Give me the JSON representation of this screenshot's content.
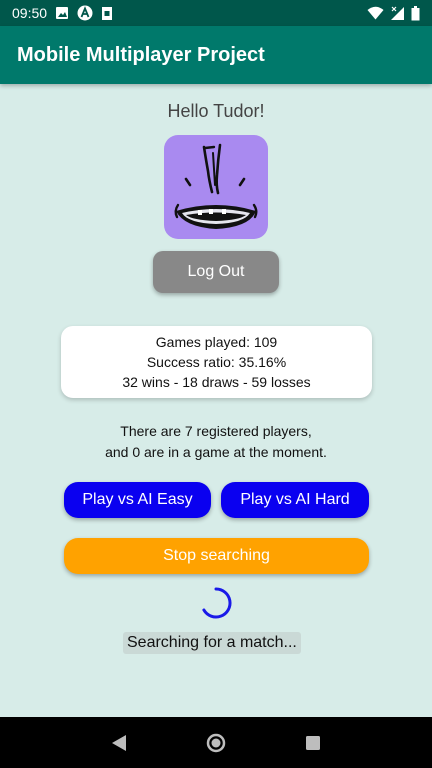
{
  "status_bar": {
    "time": "09:50",
    "left_icons": [
      "image-icon",
      "app-a-icon",
      "sd-card-icon"
    ],
    "right_icons": [
      "wifi-icon",
      "signal-icon",
      "battery-icon"
    ]
  },
  "app_bar": {
    "title": "Mobile Multiplayer Project"
  },
  "profile": {
    "greeting": "Hello Tudor!",
    "avatar_icon": "monster-avatar-icon",
    "logout_label": "Log Out"
  },
  "stats": {
    "games_played": "Games played: 109",
    "success_ratio": "Success ratio: 35.16%",
    "record": "32 wins - 18 draws - 59 losses"
  },
  "players_info": {
    "line1": "There are 7 registered players,",
    "line2": "and 0 are in a game at the moment."
  },
  "actions": {
    "ai_easy_label": "Play vs AI Easy",
    "ai_hard_label": "Play vs AI Hard",
    "stop_label": "Stop searching"
  },
  "search_status": {
    "text": "Searching for a match..."
  },
  "nav_bar": {
    "icons": [
      "back-icon",
      "home-icon",
      "recents-icon"
    ]
  },
  "colors": {
    "status_bar": "#00574b",
    "app_bar": "#00796b",
    "background": "#d7ece8",
    "ai_button": "#0a00f0",
    "stop_button": "#ffa200",
    "logout_button": "#888888",
    "avatar": "#a98af0"
  }
}
